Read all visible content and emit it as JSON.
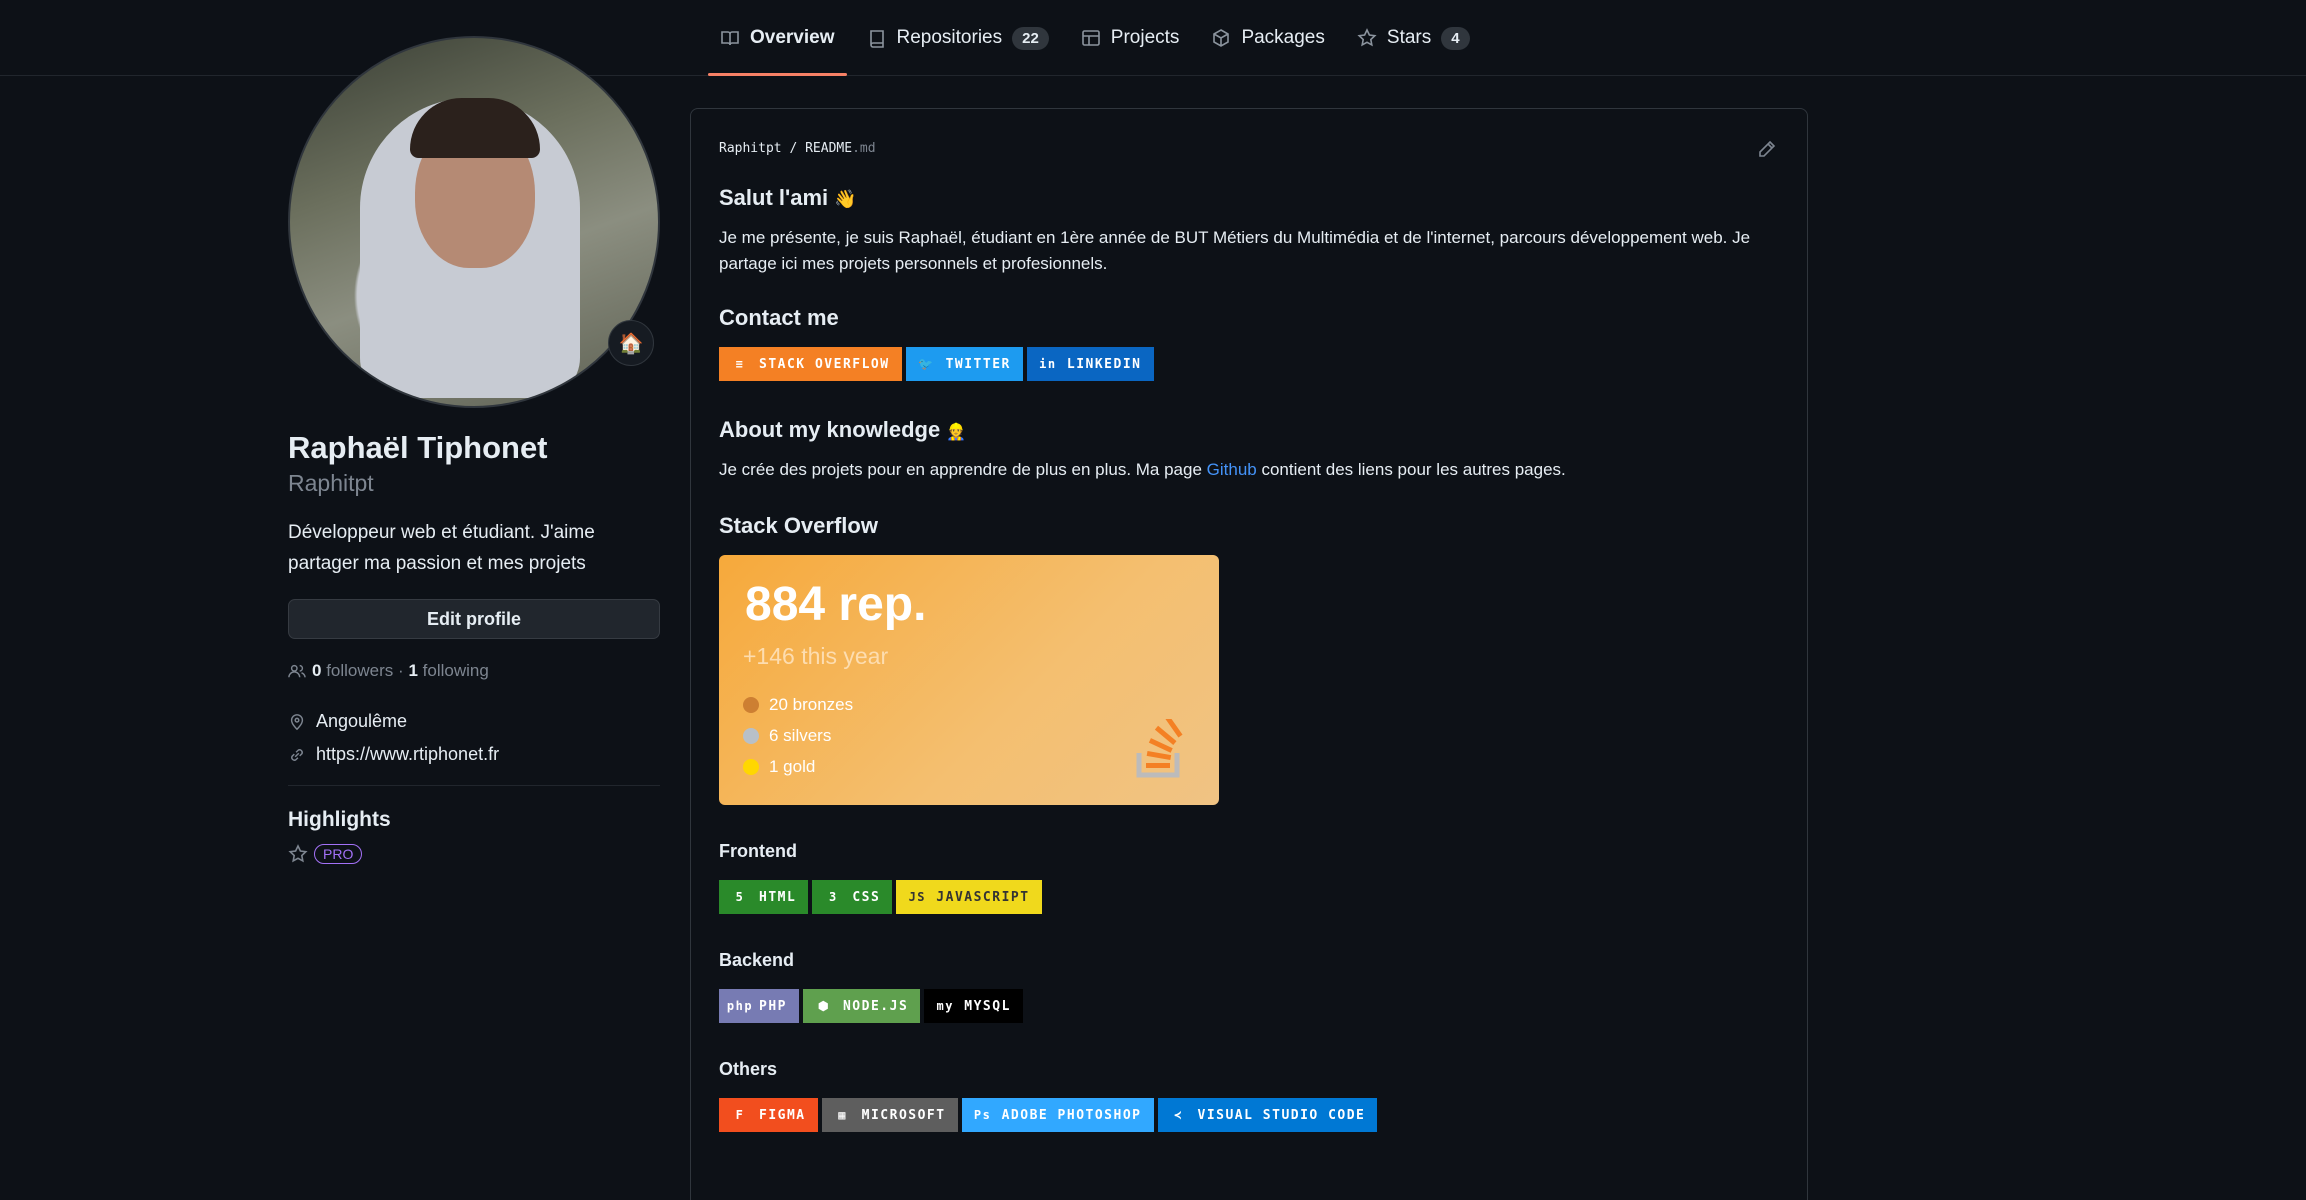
{
  "tabs": [
    {
      "label": "Overview",
      "icon": "book-icon",
      "active": true
    },
    {
      "label": "Repositories",
      "icon": "repo-icon",
      "count": "22"
    },
    {
      "label": "Projects",
      "icon": "table-icon"
    },
    {
      "label": "Packages",
      "icon": "package-icon"
    },
    {
      "label": "Stars",
      "icon": "star-icon",
      "count": "4"
    }
  ],
  "profile": {
    "status_emoji": "🏠",
    "name": "Raphaël Tiphonet",
    "login": "Raphitpt",
    "bio": "Développeur web et étudiant. J'aime partager ma passion et mes projets",
    "edit_label": "Edit profile",
    "followers_count": "0",
    "followers_label": "followers",
    "separator": "·",
    "following_count": "1",
    "following_label": "following",
    "location": "Angoulême",
    "website": "https://www.rtiphonet.fr",
    "highlights_title": "Highlights",
    "pro_label": "PRO"
  },
  "readme": {
    "path_user": "Raphitpt",
    "path_sep": "/",
    "path_file": "README",
    "path_ext": ".md",
    "greeting_title": "Salut l'ami",
    "greeting_emoji": "👋",
    "intro": "Je me présente, je suis Raphaël, étudiant en 1ère année de BUT Métiers du Multimédia et de l'internet, parcours développement web. Je partage ici mes projets personnels et profesionnels.",
    "contact_title": "Contact me",
    "contact_badges": [
      {
        "label": "STACK OVERFLOW",
        "color": "#f48024",
        "icon": "≡"
      },
      {
        "label": "TWITTER",
        "color": "#1d9bf0",
        "icon": "🐦"
      },
      {
        "label": "LINKEDIN",
        "color": "#0a66c2",
        "icon": "in"
      }
    ],
    "knowledge_title": "About my knowledge",
    "knowledge_emoji": "👷",
    "knowledge_text_before": "Je crée des projets pour en apprendre de plus en plus. Ma page ",
    "knowledge_link": "Github",
    "knowledge_text_after": " contient des liens pour les autres pages.",
    "so_title": "Stack Overflow",
    "so_card": {
      "rep": "884 rep.",
      "this_year": "+146 this year",
      "medals": [
        {
          "label": "20 bronzes",
          "color": "#cd7f32"
        },
        {
          "label": "6 silvers",
          "color": "#b8c0c8"
        },
        {
          "label": "1 gold",
          "color": "#ffd700"
        }
      ]
    },
    "frontend_title": "Frontend",
    "frontend_badges": [
      {
        "label": "HTML",
        "color": "#2a8a2a",
        "icon": "5"
      },
      {
        "label": "CSS",
        "color": "#2a8a2a",
        "icon": "3"
      },
      {
        "label": "JAVASCRIPT",
        "color": "#f0d91c",
        "icon": "JS",
        "text_color": "#333333"
      }
    ],
    "backend_title": "Backend",
    "backend_badges": [
      {
        "label": "PHP",
        "color": "#777bb3",
        "icon": "php"
      },
      {
        "label": "NODE.JS",
        "color": "#5fa04e",
        "icon": "⬢"
      },
      {
        "label": "MYSQL",
        "color": "#000000",
        "icon": "my"
      }
    ],
    "others_title": "Others",
    "others_badges": [
      {
        "label": "FIGMA",
        "color": "#f24e1e",
        "icon": "F"
      },
      {
        "label": "MICROSOFT",
        "color": "#5e5e5e",
        "icon": "▦"
      },
      {
        "label": "ADOBE PHOTOSHOP",
        "color": "#31a8ff",
        "icon": "Ps"
      },
      {
        "label": "VISUAL STUDIO CODE",
        "color": "#0078d4",
        "icon": "≺"
      }
    ]
  }
}
